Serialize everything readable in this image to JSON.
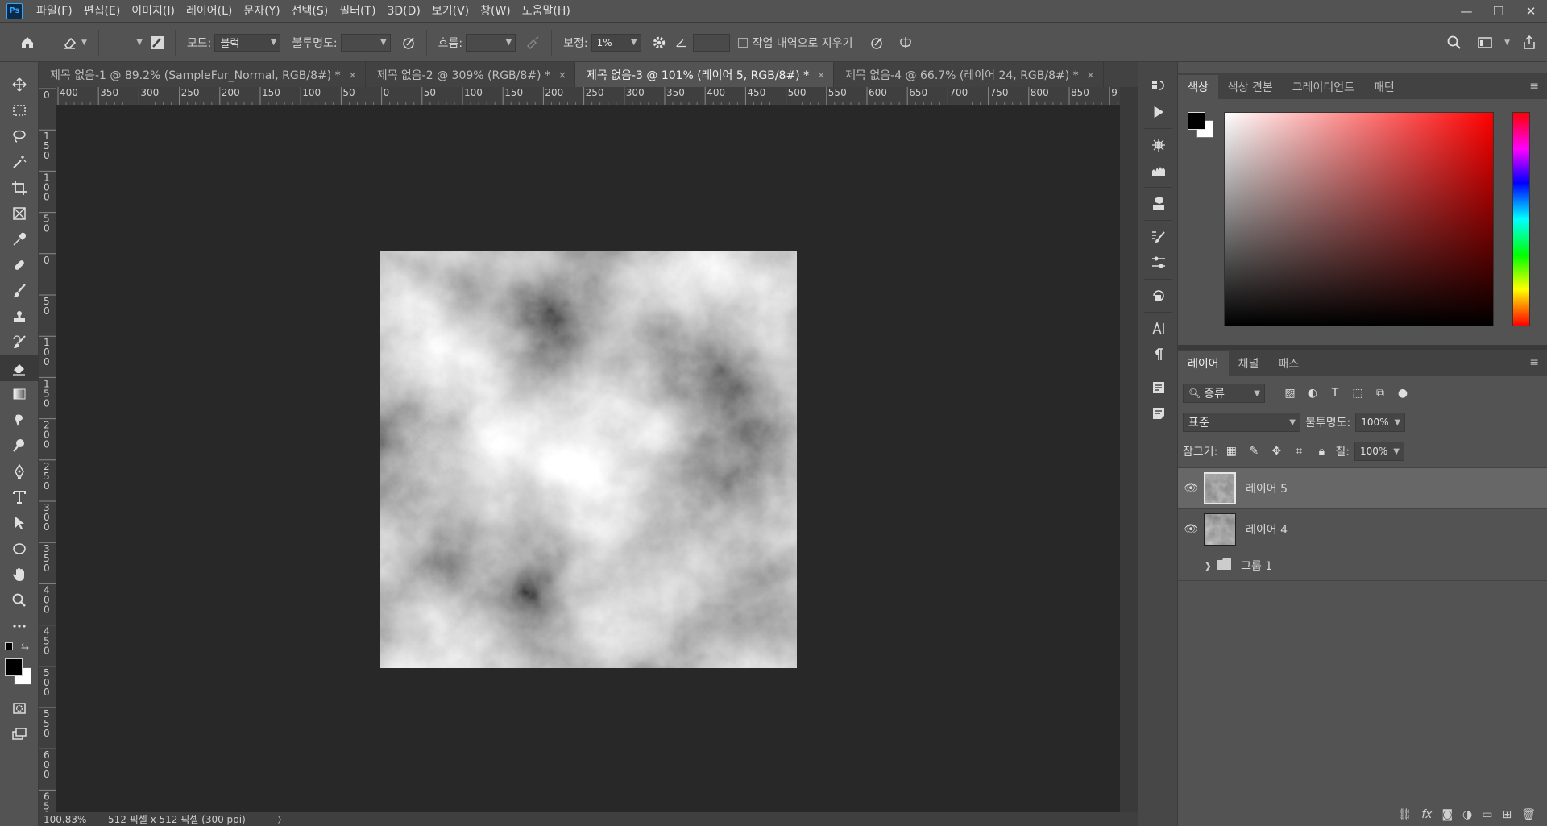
{
  "app": {
    "logo": "Ps"
  },
  "menu": [
    "파일(F)",
    "편집(E)",
    "이미지(I)",
    "레이어(L)",
    "문자(Y)",
    "선택(S)",
    "필터(T)",
    "3D(D)",
    "보기(V)",
    "창(W)",
    "도움말(H)"
  ],
  "window_controls": {
    "minimize": "—",
    "restore": "❐",
    "close": "✕"
  },
  "options": {
    "mode_label": "모드:",
    "mode_value": "블럭",
    "opacity_label": "불투명도:",
    "opacity_value": "",
    "flow_label": "흐름:",
    "flow_value": "",
    "smoothing_label": "보정:",
    "smoothing_value": "1%",
    "angle_value": "",
    "erase_history_label": "작업 내역으로 지우기"
  },
  "tabs": [
    {
      "label": "제목 없음-1 @ 89.2% (SampleFur_Normal, RGB/8#) *",
      "active": false
    },
    {
      "label": "제목 없음-2 @ 309% (RGB/8#) *",
      "active": false
    },
    {
      "label": "제목 없음-3 @ 101% (레이어 5, RGB/8#) *",
      "active": true
    },
    {
      "label": "제목 없음-4 @ 66.7% (레이어 24, RGB/8#) *",
      "active": false
    }
  ],
  "tab_close": "×",
  "ruler": {
    "h_ticks": [
      "400",
      "350",
      "300",
      "250",
      "200",
      "150",
      "100",
      "50",
      "0",
      "50",
      "100",
      "150",
      "200",
      "250",
      "300",
      "350",
      "400",
      "450",
      "500",
      "550",
      "600",
      "650",
      "700",
      "750",
      "800",
      "850",
      "9"
    ],
    "v_ticks": [
      "0",
      "1 5 0",
      "1 0 0",
      "5 0",
      "0",
      "5 0",
      "1 0 0",
      "1 5 0",
      "2 0 0",
      "2 5 0",
      "3 0 0",
      "3 5 0",
      "4 0 0",
      "4 5 0",
      "5 0 0",
      "5 5 0",
      "6 0 0",
      "6 5 0"
    ]
  },
  "status": {
    "zoom": "100.83%",
    "doc_size": "512 픽셀 x 512 픽셀 (300 ppi)",
    "arrow": "〉"
  },
  "color_panel": {
    "tabs": [
      "색상",
      "색상 견본",
      "그레이디언트",
      "패턴"
    ],
    "active": 0
  },
  "layers_panel": {
    "tabs": [
      "레이어",
      "채널",
      "패스"
    ],
    "active": 0,
    "filter_label": "종류",
    "blend_mode": "표준",
    "opacity_label": "불투명도:",
    "opacity_value": "100%",
    "lock_label": "잠그기:",
    "fill_label": "칠:",
    "fill_value": "100%",
    "layers": [
      {
        "name": "레이어 5",
        "selected": true
      },
      {
        "name": "레이어 4",
        "selected": false
      }
    ],
    "group": {
      "name": "그룹 1"
    }
  },
  "colors": {
    "accent": "#31a8ff",
    "foreground": "#000000",
    "background": "#ffffff",
    "canvas_bg": "#282828",
    "ui_bg": "#535353"
  },
  "icons": {
    "toolbar": [
      "move-icon",
      "marquee-icon",
      "lasso-icon",
      "magic-wand-icon",
      "crop-icon",
      "frame-icon",
      "eyedropper-icon",
      "healing-brush-icon",
      "brush-icon",
      "clone-stamp-icon",
      "history-brush-icon",
      "eraser-icon",
      "gradient-icon",
      "smudge-icon",
      "dodge-icon",
      "pen-icon",
      "type-icon",
      "path-selection-icon",
      "ellipse-icon",
      "hand-icon",
      "zoom-icon",
      "more-tools-icon"
    ]
  }
}
